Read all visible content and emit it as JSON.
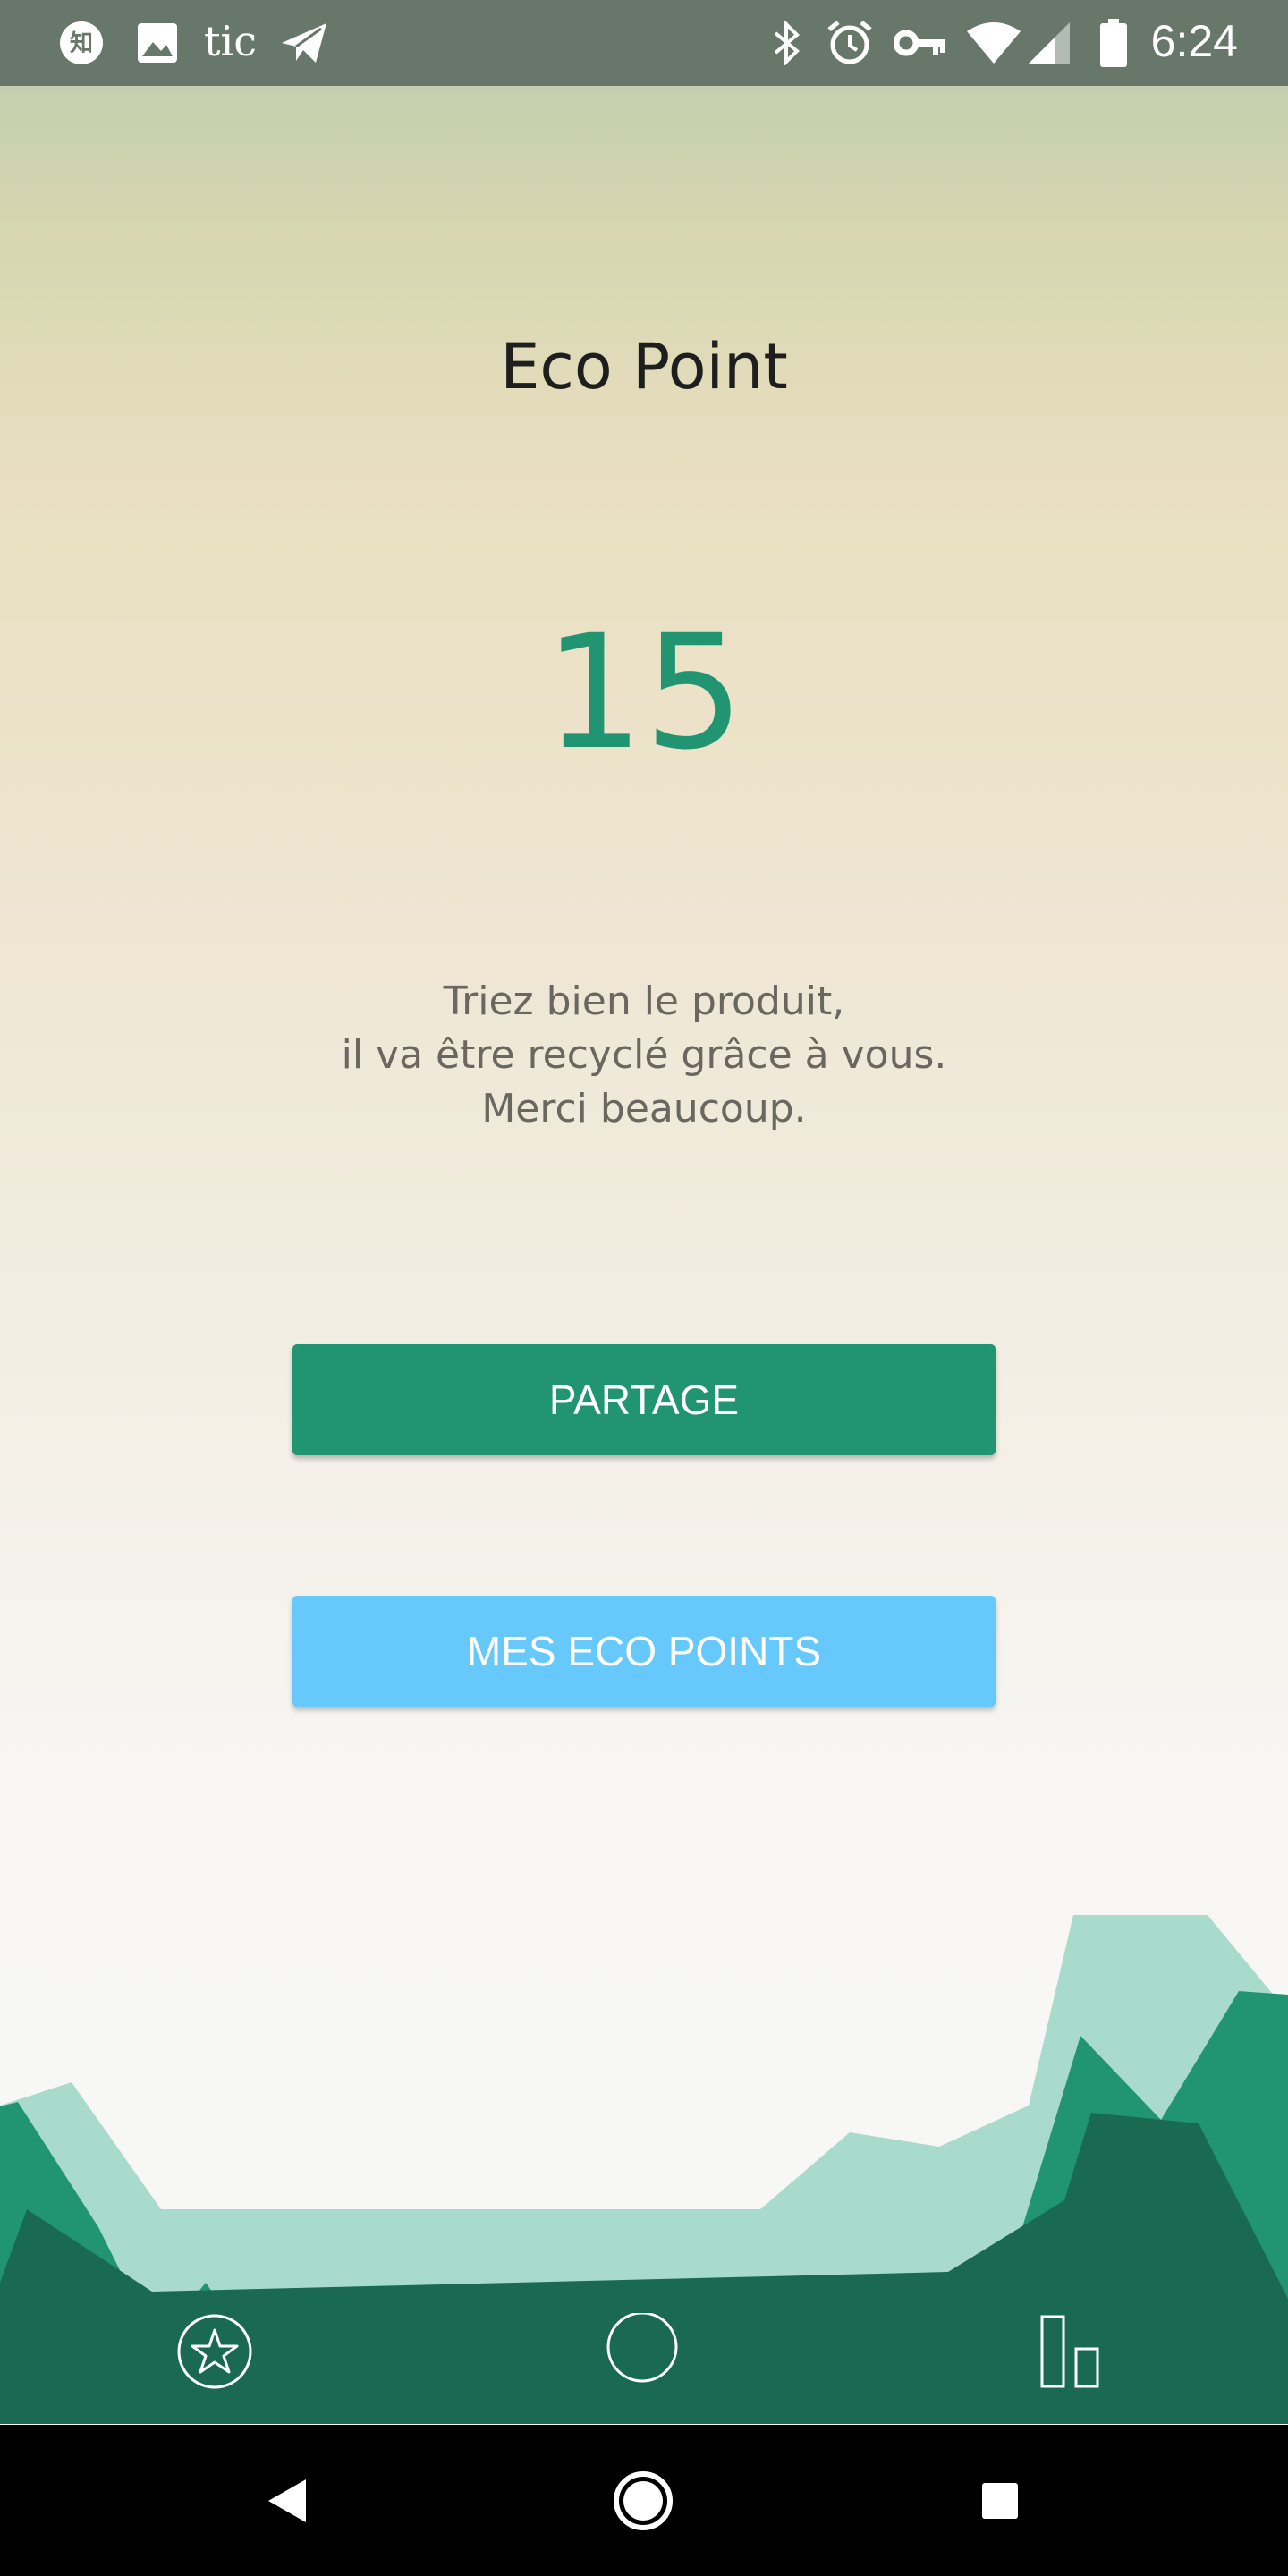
{
  "status_bar": {
    "app_text": "tic",
    "time": "6:24",
    "left_icons": [
      "zhihu-icon",
      "image-icon",
      "telegram-icon"
    ],
    "right_icons": [
      "bluetooth-icon",
      "alarm-icon",
      "vpn-key-icon",
      "wifi-icon",
      "cell-signal-icon",
      "battery-icon"
    ]
  },
  "main": {
    "title": "Eco Point",
    "points": "15",
    "message_lines": [
      "Triez bien le produit,",
      "il va être recyclé grâce à vous.",
      "Merci beaucoup."
    ]
  },
  "buttons": {
    "share_label": "PARTAGE",
    "eco_points_label": "MES ECO POINTS"
  },
  "tab_bar": {
    "tabs": [
      "star-icon",
      "circle-icon",
      "bar-chart-icon"
    ]
  },
  "nav_bar": {
    "buttons": [
      "back-icon",
      "home-icon",
      "recents-icon"
    ]
  },
  "colors": {
    "status_bar": "#67786a",
    "accent_green": "#219572",
    "button_blue": "#67c8fc",
    "mountain_light": "#a9dbcc",
    "mountain_mid": "#219572",
    "mountain_dark": "#1a6a51",
    "title_text": "#1e1e1e",
    "message_text": "#6a6660"
  }
}
